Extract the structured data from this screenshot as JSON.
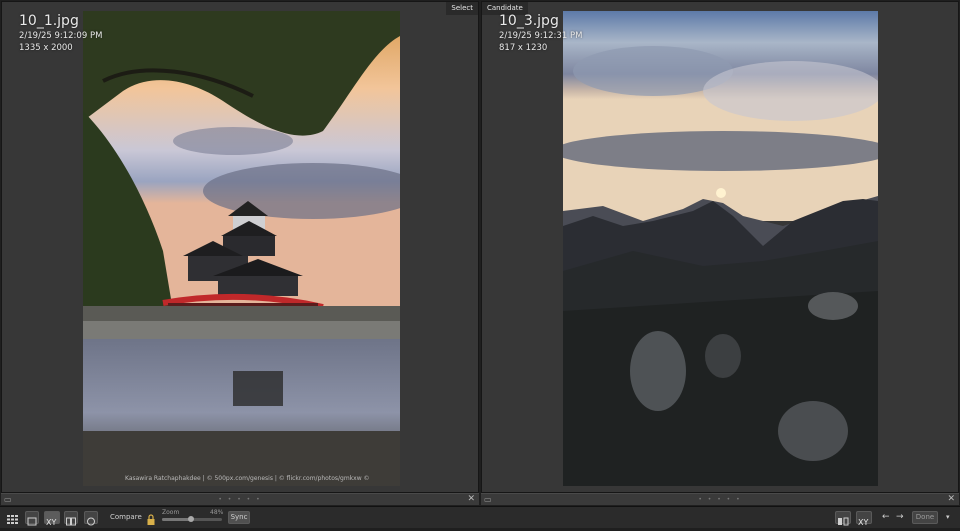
{
  "left": {
    "tag": "Select",
    "filename": "10_1.jpg",
    "datetime": "2/19/25 9:12:09 PM",
    "dimensions": "1335 x 2000",
    "credit": "Kasawira Ratchaphakdee | © 500px.com/genesis | © flickr.com/photos/gmkxw ©"
  },
  "right": {
    "tag": "Candidate",
    "filename": "10_3.jpg",
    "datetime": "2/19/25 9:12:31 PM",
    "dimensions": "817 x 1230"
  },
  "toolbar": {
    "compare_label": "Compare",
    "zoom_label": "Zoom",
    "zoom_value": "48%",
    "sync_label": "Sync",
    "done_label": "Done"
  },
  "icons": {
    "grid": "grid-icon",
    "loupe": "loupe-view-icon",
    "compare": "compare-view-icon",
    "survey": "survey-view-icon",
    "people": "people-view-icon",
    "lock": "lock-icon",
    "swap": "swap-icon",
    "make_select": "make-select-icon",
    "prev": "arrow-left-icon",
    "next": "arrow-right-icon",
    "menu": "chevron-down-icon"
  },
  "zoom_fraction": 0.48,
  "colors": {
    "panel_bg": "#373737",
    "toolbar_bg": "#2b2b2b",
    "text": "#e9e9e9"
  }
}
